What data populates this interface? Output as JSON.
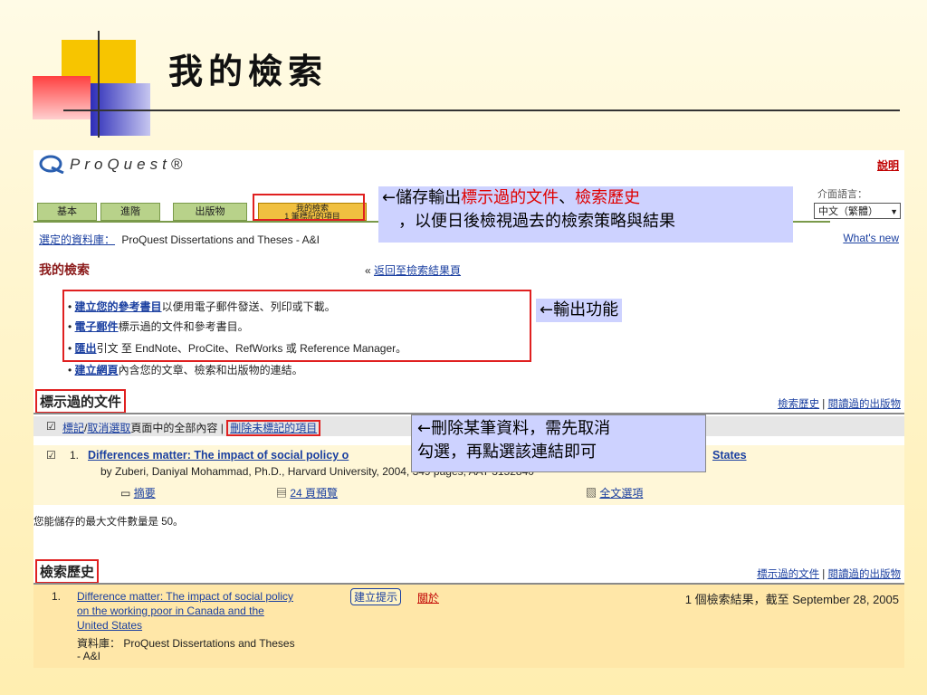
{
  "slide": {
    "title": "我的檢索"
  },
  "app": {
    "logo": "ProQuest®",
    "help": "說明",
    "tabs": [
      "基本",
      "進階",
      "出版物"
    ],
    "active_tab": {
      "line1": "我的檢索",
      "line2": "1 筆標記的項目"
    },
    "language": {
      "label": "介面語言：",
      "value": "中文（繁體）"
    },
    "db_label": "選定的資料庫：",
    "db_value": "ProQuest Dissertations and Theses - A&I",
    "whats_new": "What's new",
    "page_title": "我的檢索",
    "back_prefix": "«",
    "back_link": "返回至檢索結果頁",
    "bullets": [
      {
        "link": "建立您的參考書目",
        "text": "以便用電子郵件發送、列印或下載。"
      },
      {
        "link": "電子郵件",
        "text": "標示過的文件和參考書目。"
      },
      {
        "link": "匯出",
        "text": "引文 至 EndNote、ProCite、RefWorks 或 Reference Manager。"
      },
      {
        "link": "建立網頁",
        "text": "內含您的文章、檢索和出版物的連結。"
      }
    ],
    "marked": {
      "heading": "標示過的文件",
      "link_history": "檢索歷史",
      "link_read": "閱讀過的出版物",
      "toolbar": {
        "mark": "標記",
        "slash": "/",
        "unmark": "取消選取",
        "text": "頁面中的全部內容",
        "sep": "|",
        "delete": "刪除未標記的項目"
      },
      "item": {
        "num": "1.",
        "title": "Differences matter: The impact of social policy o",
        "title_tail": "States",
        "byline": "by Zuberi, Daniyal Mohammad, Ph.D., Harvard University, 2004, 349 pages; AAT 3152840",
        "abstract": "摘要",
        "preview": "24 頁預覽",
        "fulltext": "全文選項"
      },
      "max_note": "您能儲存的最大文件數量是 50。"
    },
    "history": {
      "heading": "檢索歷史",
      "link_marked": "標示過的文件",
      "link_read": "閱讀過的出版物",
      "item": {
        "num": "1.",
        "query_lines": [
          "Difference matter: The impact of social policy",
          "on the working poor in Canada and the",
          "United States"
        ],
        "alert": "建立提示",
        "about": "關於",
        "result": "1 個檢索結果，截至 September 28, 2005",
        "db_label": "資料庫：",
        "db_value": "ProQuest Dissertations and Theses",
        "db_tail": "- A&I"
      }
    }
  },
  "callouts": {
    "save": {
      "arrow": "←",
      "pre": "儲存輸出",
      "red1": "標示過的文件",
      "sep": "、",
      "red2": "檢索歷史",
      "line2": "，以便日後檢視過去的檢索策略與結果"
    },
    "output": "←輸出功能",
    "delete": {
      "line1": "←刪除某筆資料，需先取消",
      "line2": "勾選，再點選該連結即可"
    }
  },
  "colors": {
    "accent_red": "#e02020",
    "link": "#1a3fa0",
    "callout_bg": "#cdd2ff"
  }
}
